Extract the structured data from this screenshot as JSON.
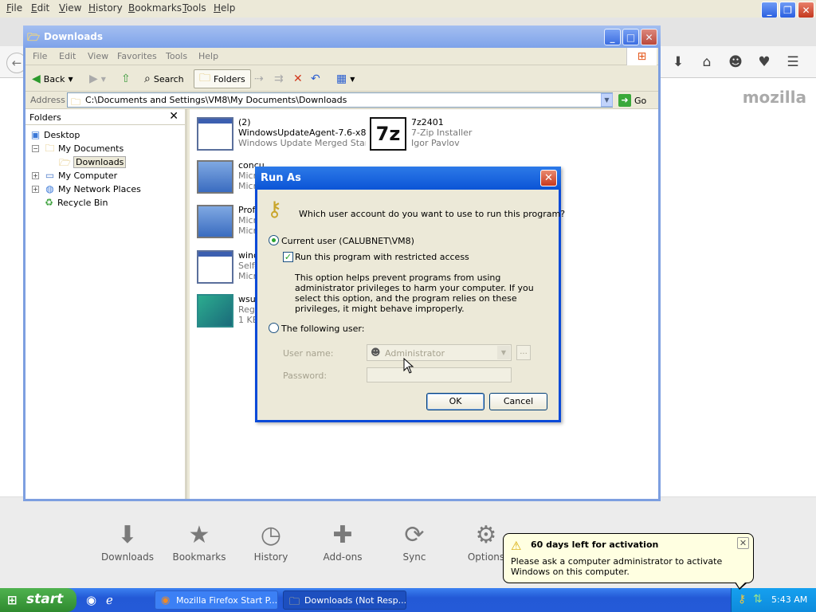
{
  "firefox": {
    "menu": [
      "File",
      "Edit",
      "View",
      "History",
      "Bookmarks",
      "Tools",
      "Help"
    ],
    "brand": "mozilla",
    "launcher": [
      "Downloads",
      "Bookmarks",
      "History",
      "Add-ons",
      "Sync",
      "Options"
    ],
    "toolbar_icons": [
      "download-icon",
      "home-icon",
      "smiley-icon",
      "pocket-icon",
      "hamburger-menu-icon"
    ]
  },
  "explorer": {
    "title": "Downloads",
    "menu": [
      "File",
      "Edit",
      "View",
      "Favorites",
      "Tools",
      "Help"
    ],
    "toolbar": {
      "back": "Back",
      "search": "Search",
      "folders": "Folders"
    },
    "address_label": "Address",
    "address_value": "C:\\Documents and Settings\\VM8\\My Documents\\Downloads",
    "go": "Go",
    "folders_header": "Folders",
    "tree": [
      "Desktop",
      "My Documents",
      "Downloads",
      "My Computer",
      "My Network Places",
      "Recycle Bin"
    ],
    "files": [
      {
        "l1": "(2)",
        "l2": "WindowsUpdateAgent-7.6-x86",
        "l3": "Windows Update Merged Stan..."
      },
      {
        "l1": "7z2401",
        "l2": "7-Zip Installer",
        "l3": "Igor Pavlov"
      },
      {
        "l1": "concu...",
        "l2": "Micro",
        "l3": "Micro"
      },
      {
        "l1": "Profil",
        "l2": "Micro",
        "l3": "Micro"
      },
      {
        "l1": "windo",
        "l2": "Self-",
        "l3": "Micro"
      },
      {
        "l1": "wsus",
        "l2": "Regi",
        "l3": "1 KB"
      }
    ]
  },
  "runas": {
    "title": "Run As",
    "question": "Which user account do you want to use to run this program?",
    "current_user": "Current user (CALUBNET\\VM8)",
    "restricted": "Run this program with restricted access",
    "description": "This option helps prevent programs from using administrator privileges to harm your computer.  If you select this option, and the program relies on these privileges, it might behave improperly.",
    "following_user": "The following user:",
    "user_name_label": "User name:",
    "user_name_value": "Administrator",
    "password_label": "Password:",
    "browse": "...",
    "ok": "OK",
    "cancel": "Cancel"
  },
  "taskbar": {
    "start": "start",
    "tasks": [
      "Mozilla Firefox Start P...",
      "Downloads (Not Resp..."
    ],
    "clock": "5:43 AM"
  },
  "balloon": {
    "title": "60 days left for activation",
    "message": "Please ask a computer administrator to activate Windows on this computer."
  }
}
